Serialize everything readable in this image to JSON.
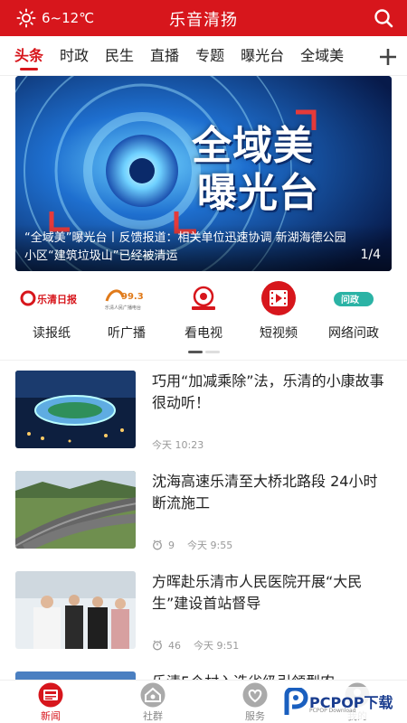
{
  "header": {
    "weather": "6~12℃",
    "title": "乐音清扬"
  },
  "tabs": [
    "头条",
    "时政",
    "民生",
    "直播",
    "专题",
    "曝光台",
    "全域美"
  ],
  "banner": {
    "title_line1": "全域美",
    "title_line2": "曝光台",
    "caption": "“全域美”曝光台丨反馈报道：相关单位迅速协调 新湖海德公园小区“建筑垃圾山”已经被清运",
    "page": "1/4"
  },
  "quick_entries": [
    {
      "label": "读报纸",
      "icon": "newspaper-logo-icon",
      "logo_text": "乐清日报"
    },
    {
      "label": "听广播",
      "icon": "radio-logo-icon",
      "logo_text": "乐清人民广播电台"
    },
    {
      "label": "看电视",
      "icon": "tv-logo-icon"
    },
    {
      "label": "短视频",
      "icon": "video-icon"
    },
    {
      "label": "网络问政",
      "icon": "wenzheng-logo-icon",
      "logo_text": "问政"
    }
  ],
  "news": [
    {
      "headline": "巧用“加减乘除”法，乐清的小康故事很动听！",
      "views": "",
      "time": "今天 10:23"
    },
    {
      "headline": "沈海高速乐清至大桥北路段 24小时断流施工",
      "views": "9",
      "time": "今天 9:55"
    },
    {
      "headline": "方晖赴乐清市人民医院开展“大民生”建设首站督导",
      "views": "46",
      "time": "今天 9:51"
    },
    {
      "headline": "乐清5个村入选省级引领型农",
      "views": "",
      "time": ""
    }
  ],
  "bottom_nav": [
    {
      "label": "新闻",
      "icon": "news-icon",
      "active": true
    },
    {
      "label": "社群",
      "icon": "community-icon",
      "active": false
    },
    {
      "label": "服务",
      "icon": "service-icon",
      "active": false
    },
    {
      "label": "我的",
      "icon": "profile-icon",
      "active": false
    }
  ],
  "watermark": {
    "text": "PCPOP下载",
    "sub": "PCPOP Download"
  },
  "colors": {
    "brand": "#d7161c",
    "muted": "#999999"
  }
}
